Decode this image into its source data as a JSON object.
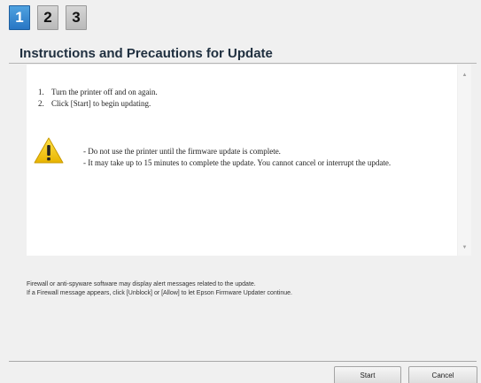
{
  "steps": [
    {
      "label": "1",
      "state": "active"
    },
    {
      "label": "2",
      "state": "inactive"
    },
    {
      "label": "3",
      "state": "inactive"
    }
  ],
  "colors": {
    "active_step": "#2f85d2",
    "warning": "#f5c800",
    "title": "#1f2f3f"
  },
  "title": "Instructions and Precautions for Update",
  "instructions": [
    {
      "num": "1.",
      "text": "Turn the printer off and on again."
    },
    {
      "num": "2.",
      "text": "Click [Start] to begin updating."
    }
  ],
  "warning": {
    "icon": "warning-triangle-icon",
    "lines": [
      "- Do not use the printer until the firmware update is complete.",
      "- It may take up to 15 minutes to complete the update. You cannot cancel or interrupt the update."
    ]
  },
  "notice": [
    "Firewall or anti-spyware software may display alert messages related to the update.",
    "If a Firewall message appears, click [Unblock] or [Allow] to let Epson Firmware Updater continue."
  ],
  "buttons": {
    "start": "Start",
    "cancel": "Cancel"
  }
}
